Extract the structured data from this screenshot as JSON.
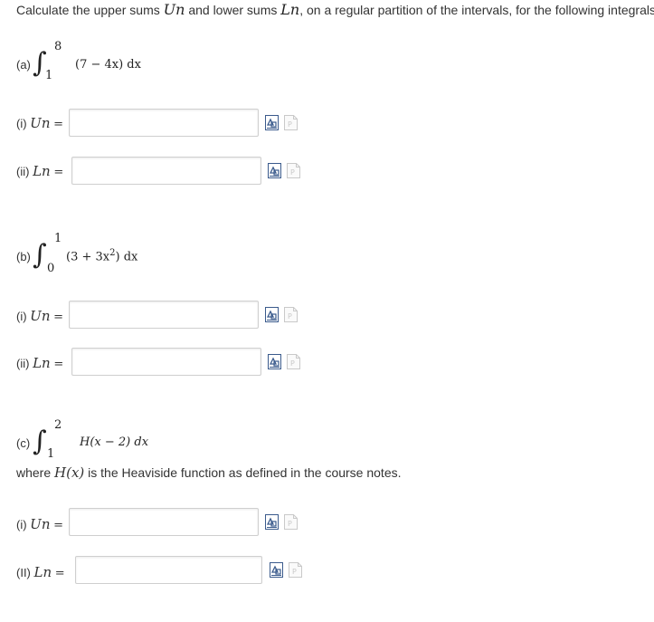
{
  "intro": {
    "pre": "Calculate the upper sums ",
    "un": "Un",
    "mid": " and lower sums ",
    "ln": "Ln",
    "post": ", on a regular partition of the intervals, for the following integrals."
  },
  "problems": [
    {
      "label": "(a)",
      "upper": "8",
      "lower": "1",
      "integrand": "(7 − 4x) dx",
      "parts": [
        {
          "label": "(i)",
          "sym": "Un",
          "eq": "=",
          "value": ""
        },
        {
          "label": "(ii)",
          "sym": "Ln",
          "eq": "=",
          "value": ""
        }
      ]
    },
    {
      "label": "(b)",
      "upper": "1",
      "lower": "0",
      "integrand_pre": "(3 + 3x",
      "integrand_sup": "2",
      "integrand_post": ") dx",
      "parts": [
        {
          "label": "(i)",
          "sym": "Un",
          "eq": "=",
          "value": ""
        },
        {
          "label": "(ii)",
          "sym": "Ln",
          "eq": "=",
          "value": ""
        }
      ]
    },
    {
      "label": "(c)",
      "upper": "2",
      "lower": "1",
      "integrand": "H(x − 2) dx",
      "note_pre": "where ",
      "note_sym": "H(x)",
      "note_post": " is the Heaviside function as defined in the course notes.",
      "parts": [
        {
          "label": "(i)",
          "sym": "Un",
          "eq": "=",
          "value": ""
        },
        {
          "label": "(II)",
          "sym": "Ln",
          "eq": "=",
          "value": ""
        }
      ]
    }
  ],
  "icons": {
    "math_editor": "math-editor-icon",
    "answer_help": "answer-help-icon",
    "math_editor_color": "#3a5a8c",
    "help_color": "#c9c9c9"
  }
}
